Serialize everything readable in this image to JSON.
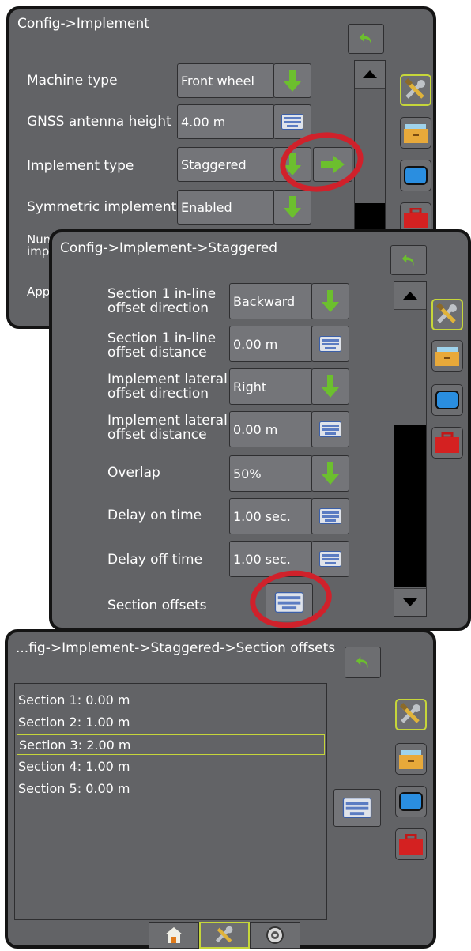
{
  "screen1": {
    "title": "Config->Implement",
    "rows": [
      {
        "label": "Machine type",
        "value": "Front wheel"
      },
      {
        "label": "GNSS antenna height",
        "value": "4.00 m"
      },
      {
        "label": "Implement type",
        "value": "Staggered"
      },
      {
        "label": "Symmetric implement",
        "value": "Enabled"
      },
      {
        "label_line1": "Num",
        "label_line2": "imp"
      },
      {
        "label": "App"
      }
    ]
  },
  "screen2": {
    "title": "Config->Implement->Staggered",
    "rows": [
      {
        "label_line1": "Section 1 in-line",
        "label_line2": "offset direction",
        "value": "Backward"
      },
      {
        "label_line1": "Section 1 in-line",
        "label_line2": "offset distance",
        "value": "0.00 m"
      },
      {
        "label_line1": "Implement lateral",
        "label_line2": "offset direction",
        "value": "Right"
      },
      {
        "label_line1": "Implement lateral",
        "label_line2": "offset distance",
        "value": "0.00 m"
      },
      {
        "label": "Overlap",
        "value": "50%"
      },
      {
        "label": "Delay on time",
        "value": "1.00 sec."
      },
      {
        "label": "Delay off time",
        "value": "1.00 sec."
      },
      {
        "label": "Section offsets"
      }
    ]
  },
  "screen3": {
    "title": "...fig->Implement->Staggered->Section offsets",
    "sections": [
      {
        "label": "Section 1: 0.00 m"
      },
      {
        "label": "Section 2: 1.00 m"
      },
      {
        "label": "Section 3: 2.00 m",
        "selected": true
      },
      {
        "label": "Section 4: 1.00 m"
      },
      {
        "label": "Section 5: 0.00 m"
      }
    ]
  },
  "icons": {
    "back": "back-arrow-icon",
    "tools": "tools-icon",
    "folder": "job-folder-icon",
    "display": "display-icon",
    "toolbox": "toolbox-icon",
    "keyboard": "keyboard-icon",
    "down": "green-down-arrow-icon",
    "right": "green-right-arrow-icon",
    "home": "home-icon",
    "gauge": "gauge-icon"
  },
  "colors": {
    "panel": "#626366",
    "accent_green": "#6cbf2e",
    "highlight": "#c6d63a",
    "annotation_red": "#d0212b"
  }
}
